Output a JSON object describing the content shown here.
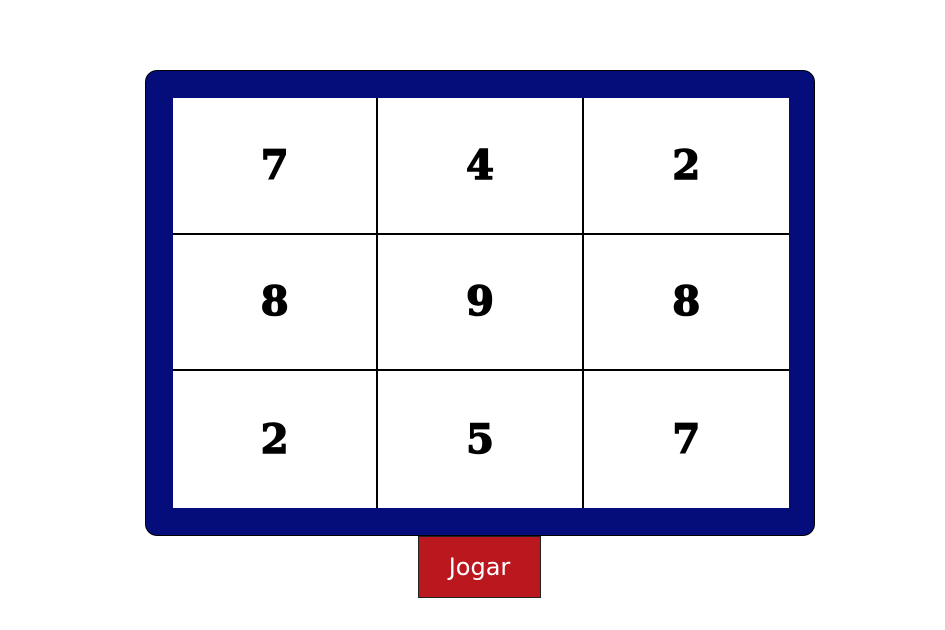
{
  "colors": {
    "board_frame": "#050d7a",
    "grid_background": "#ffffff",
    "grid_lines": "#000000",
    "button_background": "#bb171e",
    "button_text": "#ffffff"
  },
  "board": {
    "cells": [
      "7",
      "4",
      "2",
      "8",
      "9",
      "8",
      "2",
      "5",
      "7"
    ]
  },
  "controls": {
    "play_label": "Jogar"
  }
}
